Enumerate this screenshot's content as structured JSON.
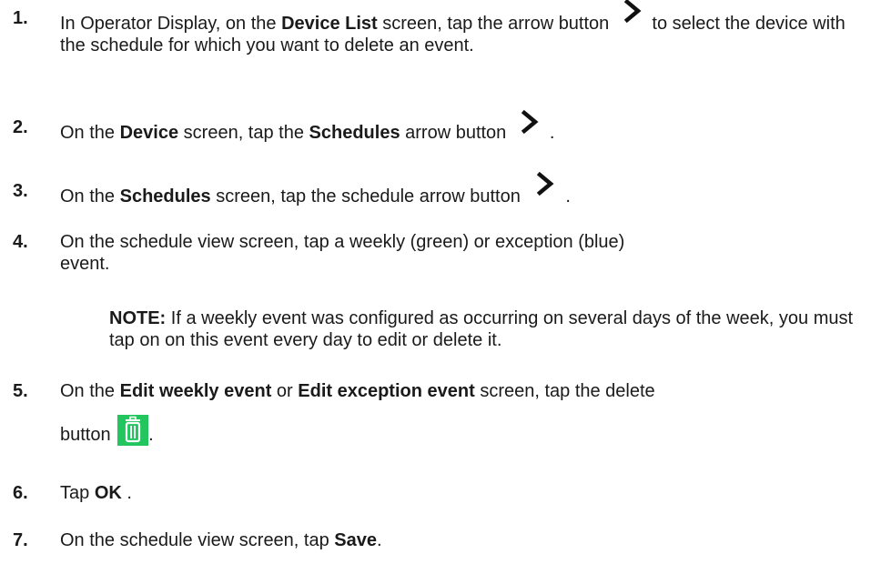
{
  "steps": [
    {
      "num": "1.",
      "pre": "In Operator Display, on the ",
      "bold1": "Device List",
      "mid": " screen, tap the arrow button ",
      "post": " to select the device with the schedule for which you want to delete an event.",
      "icon": "chevron-right-icon"
    },
    {
      "num": "2.",
      "pre": "On the ",
      "bold1": "Device",
      "mid": " screen, tap the ",
      "bold2": "Schedules",
      "mid2": " arrow button ",
      "post": ".",
      "icon": "chevron-right-icon"
    },
    {
      "num": "3.",
      "pre": "On the ",
      "bold1": "Schedules",
      "mid": " screen, tap the schedule arrow button ",
      "post": ".",
      "icon": "chevron-right-icon"
    },
    {
      "num": "4.",
      "text": "On the schedule view screen, tap a weekly (green) or exception (blue) event."
    },
    {
      "num": "5.",
      "pre": "On the ",
      "bold1": "Edit weekly event",
      "mid": " or ",
      "bold2": "Edit exception event",
      "mid2": " screen, tap the delete",
      "line2": "button ",
      "post": ".",
      "icon": "trash-icon",
      "icon_color": "#22c55e"
    },
    {
      "num": "6.",
      "pre": "Tap ",
      "bold1": "OK",
      "post": " ."
    },
    {
      "num": "7.",
      "pre": "On the schedule view screen, tap ",
      "bold1": "Save",
      "post": "."
    }
  ],
  "note": {
    "label": "NOTE:",
    "text": " If a weekly event was configured as occurring on several days of the week, you must tap on on this event every day to edit or delete it."
  }
}
